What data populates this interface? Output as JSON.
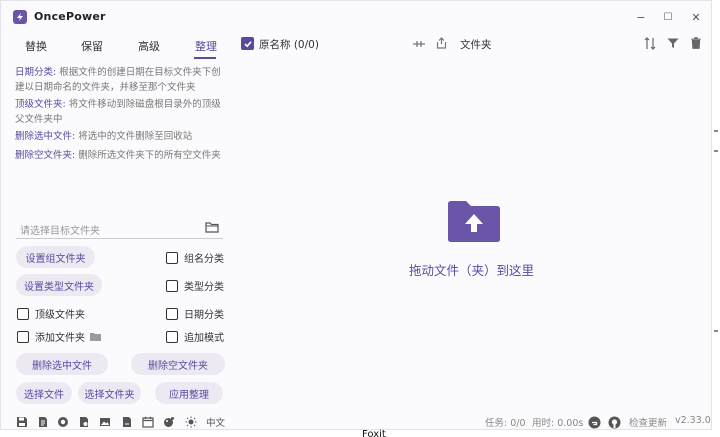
{
  "app": {
    "title": "OncePower"
  },
  "window_controls": {
    "minimize": "−",
    "maximize": "☐",
    "close": "✕"
  },
  "tabs": [
    {
      "label": "替换"
    },
    {
      "label": "保留"
    },
    {
      "label": "高级"
    },
    {
      "label": "整理",
      "active": true
    }
  ],
  "descriptions": [
    {
      "key": "日期分类:",
      "text": " 根据文件的创建日期在目标文件夹下创建以日期命名的文件夹，并移至那个文件夹"
    },
    {
      "key": "顶级文件夹:",
      "text": " 将文件移动到除磁盘根目录外的顶级父文件夹中"
    },
    {
      "key": "删除选中文件:",
      "text": " 将选中的文件删除至回收站"
    },
    {
      "key": "删除空文件夹:",
      "text": " 删除所选文件夹下的所有空文件夹"
    }
  ],
  "target_folder": {
    "placeholder": "请选择目标文件夹"
  },
  "buttons": {
    "set_group_folder": "设置组文件夹",
    "set_type_folder": "设置类型文件夹",
    "delete_selected": "删除选中文件",
    "delete_empty": "删除空文件夹",
    "select_files": "选择文件",
    "select_folders": "选择文件夹",
    "apply": "应用整理"
  },
  "checkboxes": {
    "group_classify": "组名分类",
    "type_classify": "类型分类",
    "top_folder": "顶级文件夹",
    "date_classify": "日期分类",
    "add_folder": "添加文件夹",
    "append_mode": "追加模式"
  },
  "header": {
    "original_name": "原名称 (0/0)",
    "folder": "文件夹"
  },
  "dropzone": {
    "text": "拖动文件（夹）到这里"
  },
  "bottom": {
    "lang": "中文",
    "tasks": "任务: 0/0",
    "elapsed": "用时: 0.00s",
    "check_update": "检查更新",
    "version": "v2.33.0"
  },
  "behind_window": {
    "text": "Foxit"
  },
  "colors": {
    "accent": "#5b49a0",
    "pill_bg": "#ede9f3"
  }
}
